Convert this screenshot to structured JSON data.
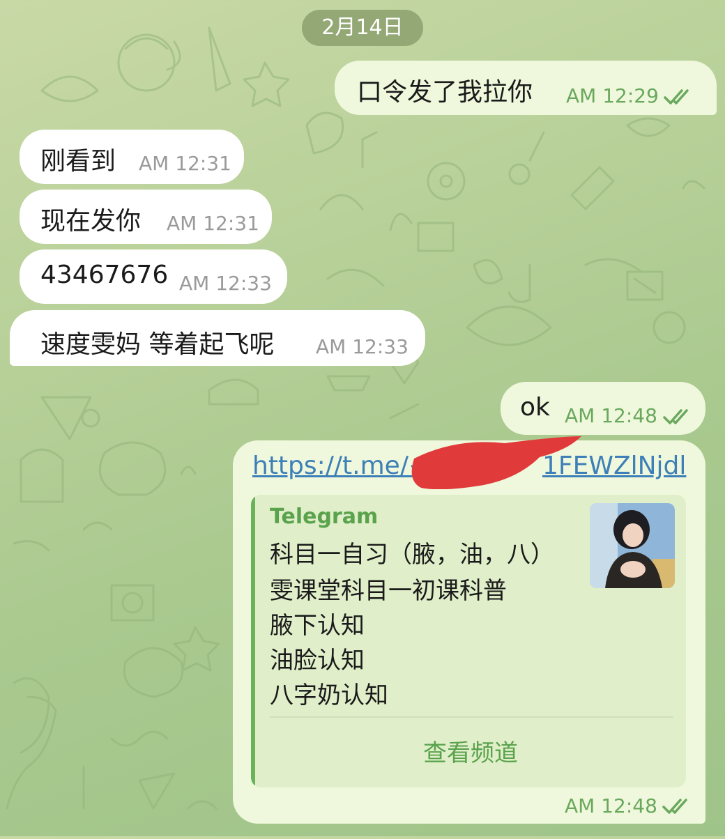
{
  "date_separator": "2月14日",
  "messages": [
    {
      "text": "口令发了我拉你",
      "time": "AM 12:29",
      "direction": "out",
      "read": true
    },
    {
      "text": "刚看到",
      "time": "AM 12:31",
      "direction": "in"
    },
    {
      "text": "现在发你",
      "time": "AM 12:31",
      "direction": "in"
    },
    {
      "text": "43467676",
      "time": "AM 12:33",
      "direction": "in"
    },
    {
      "text": "速度雯妈 等着起飞呢",
      "time": "AM 12:33",
      "direction": "in"
    },
    {
      "text": "ok",
      "time": "AM 12:48",
      "direction": "out",
      "read": true
    },
    {
      "direction": "out",
      "read": true,
      "time": "AM 12:48",
      "link_visible_start": "https://t.me/+",
      "link_visible_end": "1FEWZlNjdl",
      "preview": {
        "site": "Telegram",
        "title": "科目一自习（腋，油，八）",
        "description": [
          "雯课堂科目一初课科普",
          "腋下认知",
          "油脸认知",
          "八字奶认知"
        ],
        "button": "查看频道",
        "thumbnail_icon": "channel-avatar-photo"
      }
    }
  ],
  "colors": {
    "incoming_bubble": "#ffffff",
    "outgoing_bubble": "#eff8dc",
    "link": "#3d7fb8",
    "accent_green": "#5aa24c",
    "redaction": "#e03a3a"
  }
}
